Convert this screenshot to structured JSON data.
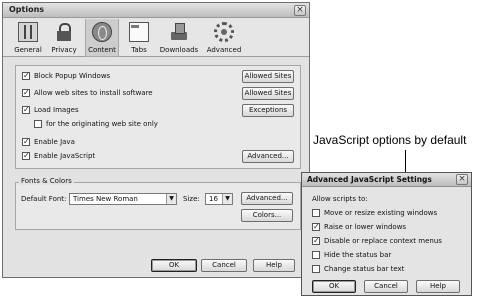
{
  "options_window": {
    "title": "Options",
    "toolbar": [
      {
        "label": "General",
        "icon": "general-icon"
      },
      {
        "label": "Privacy",
        "icon": "lock-icon"
      },
      {
        "label": "Content",
        "icon": "globe-icon",
        "active": true
      },
      {
        "label": "Tabs",
        "icon": "tabs-icon"
      },
      {
        "label": "Downloads",
        "icon": "downloads-icon"
      },
      {
        "label": "Advanced",
        "icon": "gear-icon"
      }
    ],
    "content": {
      "block_popups": {
        "label": "Block Popup Windows",
        "checked": true,
        "button": "Allowed Sites"
      },
      "allow_install": {
        "label": "Allow web sites to install software",
        "checked": true,
        "button": "Allowed Sites"
      },
      "load_images": {
        "label": "Load Images",
        "checked": true,
        "button": "Exceptions"
      },
      "originating_only": {
        "label": "for the originating web site only",
        "checked": false
      },
      "enable_java": {
        "label": "Enable Java",
        "checked": true
      },
      "enable_javascript": {
        "label": "Enable JavaScript",
        "checked": true,
        "button": "Advanced..."
      }
    },
    "fonts_colors": {
      "legend": "Fonts & Colors",
      "default_font_label": "Default Font:",
      "default_font_value": "Times New Roman",
      "size_label": "Size:",
      "size_value": "16",
      "advanced_button": "Advanced...",
      "colors_button": "Colors..."
    },
    "buttons": {
      "ok": "OK",
      "cancel": "Cancel",
      "help": "Help"
    }
  },
  "annotation": "JavaScript options by default",
  "js_settings": {
    "title": "Advanced JavaScript Settings",
    "intro": "Allow scripts to:",
    "options": [
      {
        "label": "Move or resize existing windows",
        "checked": false
      },
      {
        "label": "Raise or lower windows",
        "checked": true
      },
      {
        "label": "Disable or replace context menus",
        "checked": true
      },
      {
        "label": "Hide the status bar",
        "checked": false
      },
      {
        "label": "Change status bar text",
        "checked": false
      }
    ],
    "buttons": {
      "ok": "OK",
      "cancel": "Cancel",
      "help": "Help"
    }
  },
  "glyphs": {
    "close": "×",
    "check": "✓",
    "dropdown": "▼"
  }
}
